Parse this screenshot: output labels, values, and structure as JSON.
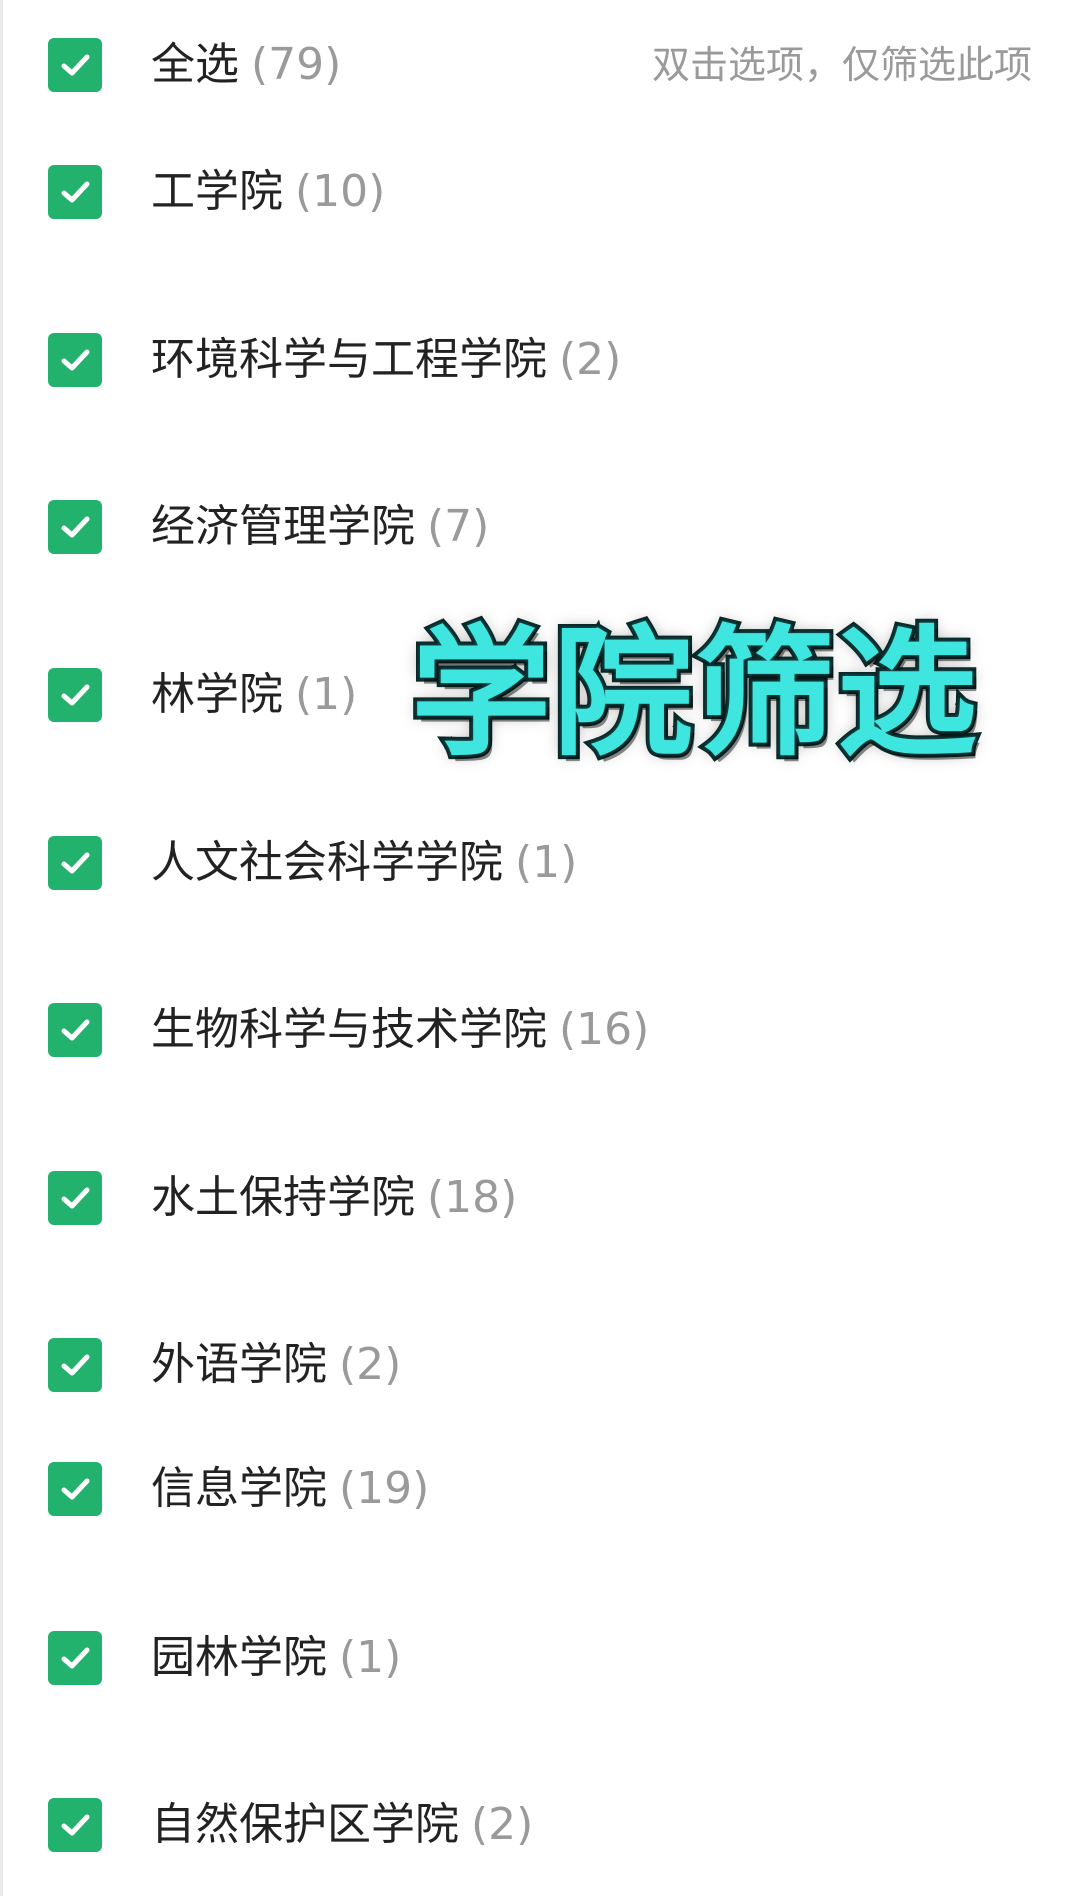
{
  "hint": "双击选项，仅筛选此项",
  "overlay_title": "学院筛选",
  "accent_color": "#23b26d",
  "icons": {
    "checkbox": "checkmark-icon"
  },
  "items": [
    {
      "label": "全选",
      "count": "(79)",
      "checked": true
    },
    {
      "label": "工学院",
      "count": "(10)",
      "checked": true
    },
    {
      "label": "环境科学与工程学院",
      "count": "(2)",
      "checked": true
    },
    {
      "label": "经济管理学院",
      "count": "(7)",
      "checked": true
    },
    {
      "label": "林学院",
      "count": "(1)",
      "checked": true
    },
    {
      "label": "人文社会科学学院",
      "count": "(1)",
      "checked": true
    },
    {
      "label": "生物科学与技术学院",
      "count": "(16)",
      "checked": true
    },
    {
      "label": "水土保持学院",
      "count": "(18)",
      "checked": true
    },
    {
      "label": "外语学院",
      "count": "(2)",
      "checked": true
    },
    {
      "label": "信息学院",
      "count": "(19)",
      "checked": true
    },
    {
      "label": "园林学院",
      "count": "(1)",
      "checked": true
    },
    {
      "label": "自然保护区学院",
      "count": "(2)",
      "checked": true
    }
  ]
}
